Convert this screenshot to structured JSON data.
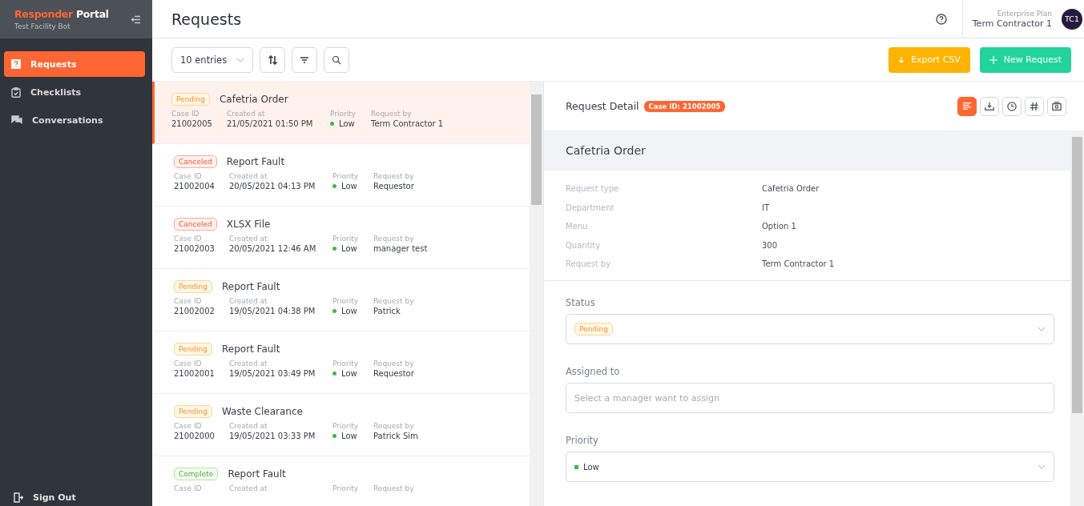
{
  "sidebar": {
    "brand_primary": "Responder",
    "brand_secondary": "Portal",
    "subtitle": "Test Facility Bot",
    "items": [
      {
        "label": "Requests",
        "selected": true
      },
      {
        "label": "Checklists",
        "selected": false
      },
      {
        "label": "Conversations",
        "selected": false
      }
    ],
    "sign_out": "Sign Out"
  },
  "header": {
    "title": "Requests",
    "plan": "Enterprise Plan",
    "user": "Term Contractor 1",
    "avatar": "TC1"
  },
  "toolbar": {
    "entries": "10 entries",
    "export": "Export CSV",
    "new": "New Request"
  },
  "requests": [
    {
      "status": "Pending",
      "kind": "pending",
      "title": "Cafetria Order",
      "selected": true,
      "fields": [
        {
          "label": "Case ID",
          "value": "21002005"
        },
        {
          "label": "Created at",
          "value": "21/05/2021 01:50 PM"
        },
        {
          "label": "Priority",
          "value": "Low",
          "color": "#3cb94a"
        },
        {
          "label": "Request by",
          "value": "Term Contractor 1"
        }
      ]
    },
    {
      "status": "Canceled",
      "kind": "canceled",
      "title": "Report Fault",
      "selected": false,
      "fields": [
        {
          "label": "Case ID",
          "value": "21002004"
        },
        {
          "label": "Created at",
          "value": "20/05/2021 04:13 PM"
        },
        {
          "label": "Priority",
          "value": "Low",
          "color": "#3cb94a"
        },
        {
          "label": "Request by",
          "value": "Requestor"
        }
      ]
    },
    {
      "status": "Canceled",
      "kind": "canceled",
      "title": "XLSX File",
      "selected": false,
      "fields": [
        {
          "label": "Case ID",
          "value": "21002003"
        },
        {
          "label": "Created at",
          "value": "20/05/2021 12:46 AM"
        },
        {
          "label": "Priority",
          "value": "Low",
          "color": "#3cb94a"
        },
        {
          "label": "Request by",
          "value": "manager test"
        }
      ]
    },
    {
      "status": "Pending",
      "kind": "pending",
      "title": "Report Fault",
      "selected": false,
      "fields": [
        {
          "label": "Case ID",
          "value": "21002002"
        },
        {
          "label": "Created at",
          "value": "19/05/2021 04:38 PM"
        },
        {
          "label": "Priority",
          "value": "Low",
          "color": "#3cb94a"
        },
        {
          "label": "Request by",
          "value": "Patrick"
        }
      ]
    },
    {
      "status": "Pending",
      "kind": "pending",
      "title": "Report Fault",
      "selected": false,
      "fields": [
        {
          "label": "Case ID",
          "value": "21002001"
        },
        {
          "label": "Created at",
          "value": "19/05/2021 03:49 PM"
        },
        {
          "label": "Priority",
          "value": "Low",
          "color": "#3cb94a"
        },
        {
          "label": "Request by",
          "value": "Requestor"
        }
      ]
    },
    {
      "status": "Pending",
      "kind": "pending",
      "title": "Waste Clearance",
      "selected": false,
      "fields": [
        {
          "label": "Case ID",
          "value": "21002000"
        },
        {
          "label": "Created at",
          "value": "19/05/2021 03:33 PM"
        },
        {
          "label": "Priority",
          "value": "Low",
          "color": "#3cb94a"
        },
        {
          "label": "Request by",
          "value": "Patrick Sim"
        }
      ]
    },
    {
      "status": "Complete",
      "kind": "complete",
      "title": "Report Fault",
      "selected": false,
      "fields": [
        {
          "label": "Case ID"
        },
        {
          "label": "Created at"
        },
        {
          "label": "Priority"
        },
        {
          "label": "Request by"
        }
      ]
    }
  ],
  "detail": {
    "title": "Request Detail",
    "case_badge": "Case ID: 21002005",
    "tools": [
      {
        "selected": true
      },
      {
        "selected": false
      },
      {
        "selected": false
      },
      {
        "selected": false
      },
      {
        "selected": false
      }
    ],
    "name": "Cafetria Order",
    "info": [
      {
        "label": "Request type",
        "value": "Cafetria Order"
      },
      {
        "label": "Department",
        "value": "IT"
      },
      {
        "label": "Menu",
        "value": "Option 1"
      },
      {
        "label": "Quantity",
        "value": "300"
      },
      {
        "label": "Request by",
        "value": "Term Contractor 1"
      }
    ],
    "status": {
      "label": "Status",
      "value": "Pending",
      "kind": "pending"
    },
    "assigned_label": "Assigned to",
    "assigned_placeholder": "Select a manager want to assign",
    "priority": {
      "label": "Priority",
      "value": "Low",
      "color": "#3cb94a"
    }
  }
}
